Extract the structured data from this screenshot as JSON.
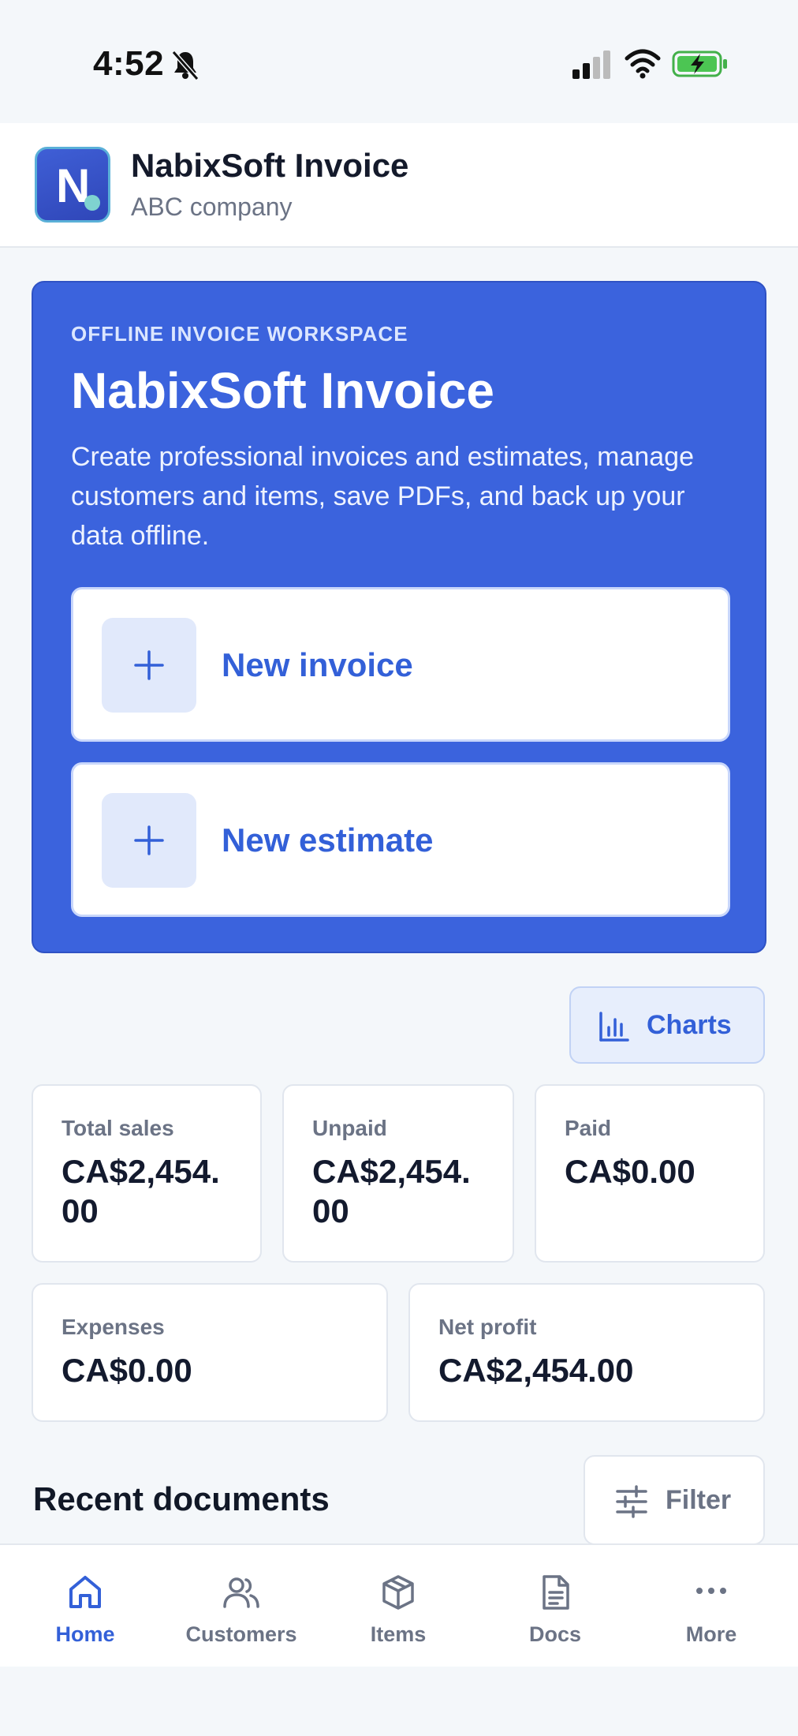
{
  "status_bar": {
    "time": "4:52",
    "icons": [
      "bell-slash-icon",
      "cellular-signal-icon",
      "wifi-icon",
      "battery-charging-icon"
    ]
  },
  "header": {
    "logo_letter": "N",
    "title": "NabixSoft Invoice",
    "subtitle": "ABC company"
  },
  "hero": {
    "eyebrow": "OFFLINE INVOICE WORKSPACE",
    "title": "NabixSoft Invoice",
    "description": "Create professional invoices and estimates, manage customers and items, save PDFs, and back up your data offline.",
    "actions": [
      {
        "label": "New invoice",
        "icon": "plus-icon"
      },
      {
        "label": "New estimate",
        "icon": "plus-icon"
      }
    ]
  },
  "charts_button": {
    "label": "Charts",
    "icon": "bar-chart-icon"
  },
  "stats": [
    {
      "label": "Total sales",
      "value": "CA$2,454.00"
    },
    {
      "label": "Unpaid",
      "value": "CA$2,454.00"
    },
    {
      "label": "Paid",
      "value": "CA$0.00"
    },
    {
      "label": "Expenses",
      "value": "CA$0.00"
    },
    {
      "label": "Net profit",
      "value": "CA$2,454.00"
    }
  ],
  "recent": {
    "title": "Recent documents",
    "filter_label": "Filter",
    "filter_icon": "sliders-icon"
  },
  "nav": [
    {
      "label": "Home",
      "icon": "home-icon",
      "active": true
    },
    {
      "label": "Customers",
      "icon": "users-icon",
      "active": false
    },
    {
      "label": "Items",
      "icon": "box-icon",
      "active": false
    },
    {
      "label": "Docs",
      "icon": "document-icon",
      "active": false
    },
    {
      "label": "More",
      "icon": "more-dots-icon",
      "active": false
    }
  ],
  "colors": {
    "primary": "#3b63dd",
    "accent_text": "#3360d8",
    "background": "#f4f7fa",
    "muted_text": "#6b7385"
  }
}
